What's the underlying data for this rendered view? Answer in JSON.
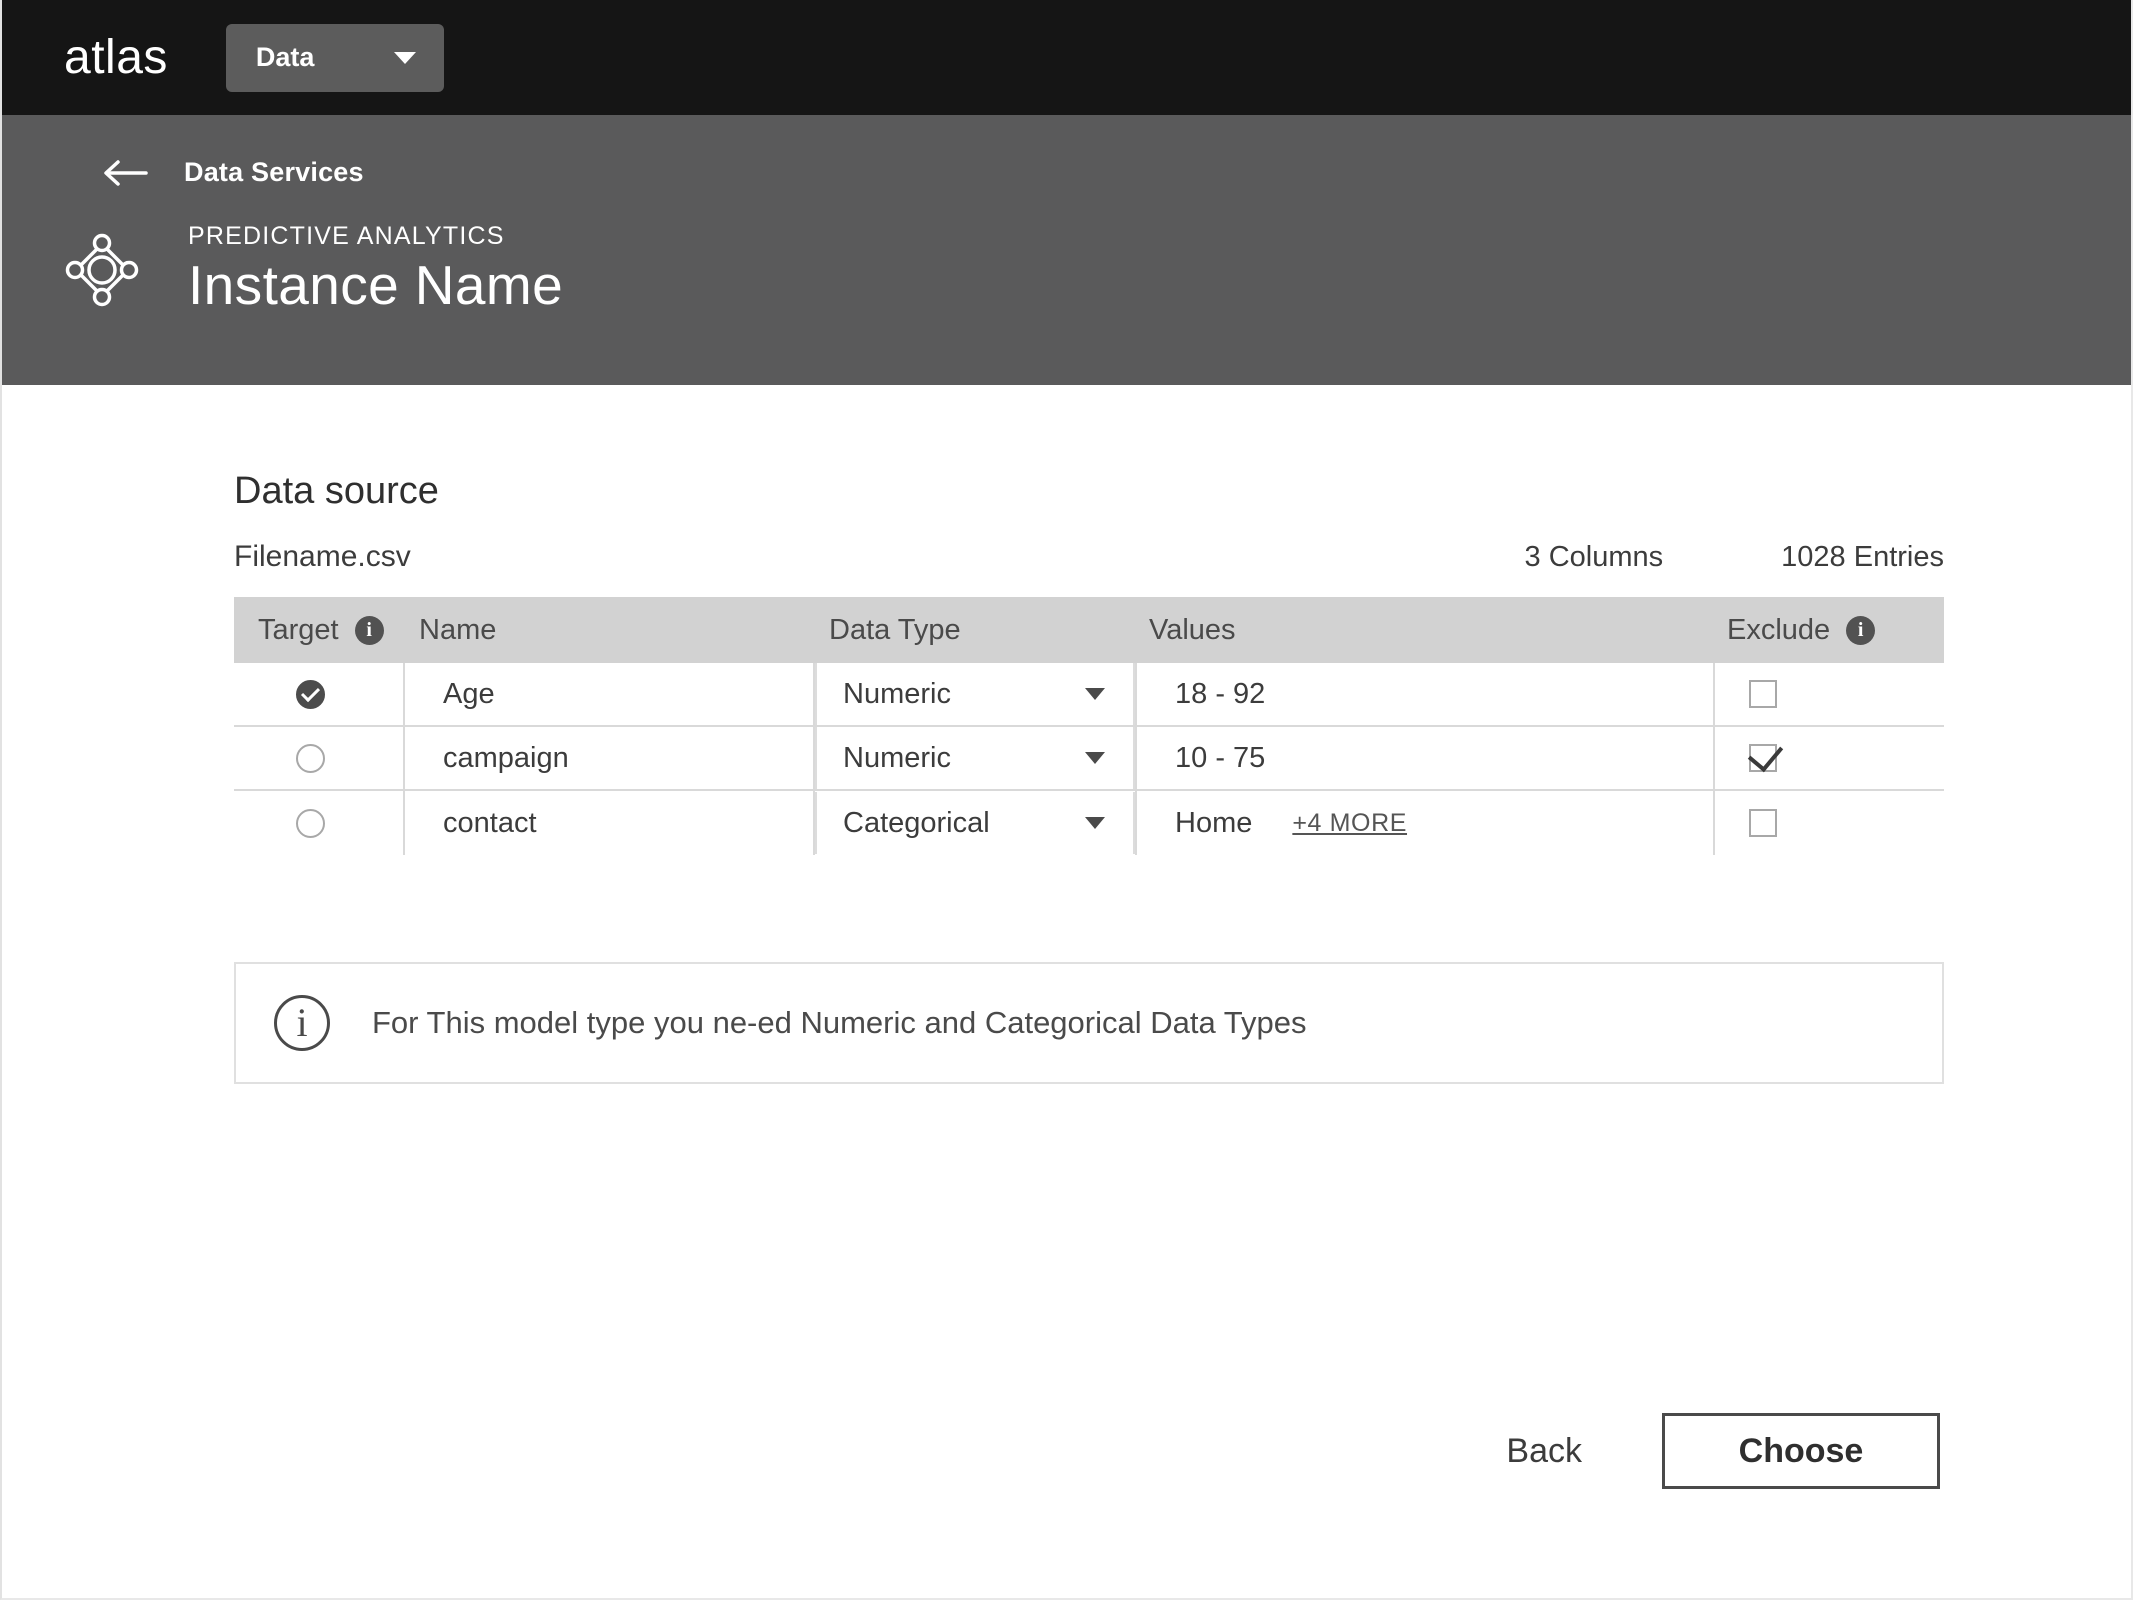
{
  "topbar": {
    "brand": "atlas",
    "dropdown_label": "Data",
    "dropdown_icon": "chevron-down-icon"
  },
  "subheader": {
    "back_icon": "arrow-left-icon",
    "back_label": "Data Services",
    "logo_icon": "predictive-analytics-node-diamond-icon",
    "eyebrow": "PREDICTIVE ANALYTICS",
    "instance_name": "Instance Name"
  },
  "main": {
    "section_title": "Data source",
    "filename": "Filename.csv",
    "columns_count": "3 Columns",
    "entries_count": "1028 Entries"
  },
  "table": {
    "headers": {
      "target": "Target",
      "target_info_icon": "info-icon",
      "name": "Name",
      "data_type": "Data Type",
      "values": "Values",
      "exclude": "Exclude",
      "exclude_info_icon": "info-icon"
    },
    "rows": [
      {
        "target_selected": true,
        "name": "Age",
        "data_type": "Numeric",
        "values": "18 - 92",
        "values_more": "",
        "excluded": false
      },
      {
        "target_selected": false,
        "name": "campaign",
        "data_type": "Numeric",
        "values": "10 - 75",
        "values_more": "",
        "excluded": true
      },
      {
        "target_selected": false,
        "name": "contact",
        "data_type": "Categorical",
        "values": "Home",
        "values_more": "+4 MORE",
        "excluded": false
      }
    ]
  },
  "banner": {
    "icon": "info-circle-icon",
    "text": "For This model type you ne-ed Numeric and Categorical Data Types"
  },
  "actions": {
    "back_label": "Back",
    "choose_label": "Choose"
  },
  "colors": {
    "topbar_bg": "#151515",
    "subheader_bg": "#5a5a5b",
    "table_header_bg": "#d2d2d2",
    "accent_dark": "#4c4c4c",
    "border": "#d9d9d9",
    "text": "#3c3c3c"
  }
}
